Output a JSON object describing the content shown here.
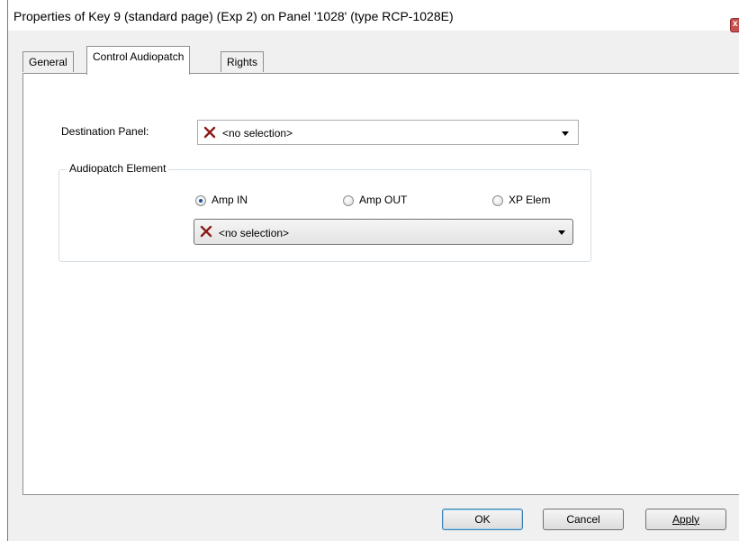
{
  "window": {
    "title": "Properties of Key 9 (standard page) (Exp 2) on Panel '1028' (type RCP-1028E)",
    "close_glyph": "x"
  },
  "tabs": [
    {
      "label": "General",
      "active": false
    },
    {
      "label": "Control Audiopatch",
      "active": true
    },
    {
      "label": "Rights",
      "active": false
    }
  ],
  "destination": {
    "label": "Destination Panel:",
    "value": "<no selection>",
    "icon": "red-x-icon"
  },
  "audiopatch": {
    "group_title": "Audiopatch Element",
    "options": [
      {
        "label": "Amp IN",
        "checked": true
      },
      {
        "label": "Amp OUT",
        "checked": false
      },
      {
        "label": "XP Elem",
        "checked": false
      }
    ],
    "element_value": "<no selection>"
  },
  "buttons": {
    "ok": "OK",
    "cancel": "Cancel",
    "apply": "Apply"
  },
  "colors": {
    "x_icon": "#8b1a1a",
    "panel_bg": "#ffffff",
    "dialog_bg": "#f0f0f0"
  }
}
